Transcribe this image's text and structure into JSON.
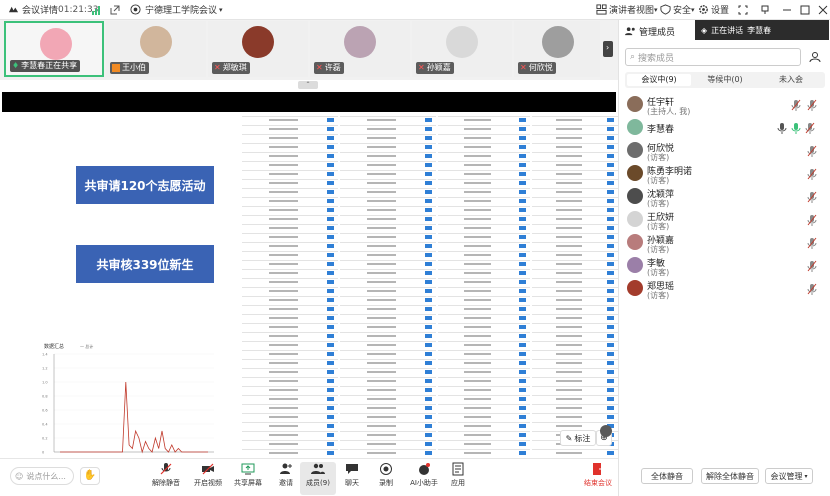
{
  "topbar": {
    "meeting_info": "会议详情",
    "timer": "01:21:33",
    "meeting_title": "宁德理工学院会议",
    "speaker_view": "演讲者视图",
    "security": "安全",
    "settings": "设置"
  },
  "strip": {
    "tiles": [
      {
        "name": "李慧春正在共享",
        "active": true
      },
      {
        "name": "王小伯"
      },
      {
        "name": "郑敏琪"
      },
      {
        "name": "许磊"
      },
      {
        "name": "孙颖嘉"
      },
      {
        "name": "何欣悦"
      }
    ]
  },
  "share": {
    "label1": "共审请120个志愿活动",
    "label2": "共审核339位新生",
    "annotate": "标注",
    "collapse": "⌃",
    "chart_title": "数据汇总",
    "chart_legend": "— 总计"
  },
  "chart_data": {
    "type": "line",
    "title": "数据汇总",
    "xlabel": "",
    "ylabel": "",
    "ylim": [
      0,
      1.4
    ],
    "y_ticks": [
      "1.4",
      "1.2",
      "1.0",
      "0.8",
      "0.6",
      "0.4",
      "0.2",
      "0"
    ],
    "series": [
      {
        "name": "总计",
        "color": "#c0392b",
        "values": [
          0,
          0,
          0,
          0,
          0,
          0,
          0,
          0,
          0,
          0,
          0,
          0,
          0,
          0,
          0,
          0,
          0,
          0,
          0,
          0,
          1.0,
          0.1,
          0.05,
          0.3,
          0.2,
          0,
          0.15,
          0.05,
          0,
          0.2,
          0.05,
          0.3,
          0.05,
          0,
          0.1,
          0,
          0.05,
          0,
          0,
          0,
          0,
          0,
          0,
          0,
          0,
          0
        ]
      }
    ]
  },
  "sharing_banner": {
    "prefix": "正在讲话",
    "name": "李慧春"
  },
  "panel": {
    "title": "管理成员",
    "search_placeholder": "搜索成员",
    "tabs": [
      "会议中(9)",
      "等候中(0)",
      "未入会"
    ],
    "members": [
      {
        "name": "任宇轩",
        "role": "(主持人, 我)",
        "color": "#8a6d5a"
      },
      {
        "name": "李慧春",
        "role": "",
        "color": "#7fb89c"
      },
      {
        "name": "何欣悦",
        "role": "(访客)",
        "color": "#6d6d6d"
      },
      {
        "name": "陈勇李明诺",
        "role": "(访客)",
        "color": "#6b4a2a"
      },
      {
        "name": "沈颖萍",
        "role": "(访客)",
        "color": "#4d4d4d"
      },
      {
        "name": "王欣妍",
        "role": "(访客)",
        "color": "#d4d4d4"
      },
      {
        "name": "孙颖嘉",
        "role": "(访客)",
        "color": "#b87c7c"
      },
      {
        "name": "李敏",
        "role": "(访客)",
        "color": "#9b7fa8"
      },
      {
        "name": "郑思瑶",
        "role": "(访客)",
        "color": "#a33c2c"
      }
    ],
    "mute_all": "全体静音",
    "unmute_all": "解除全体静音",
    "more": "会议管理"
  },
  "toolbar": {
    "chat_placeholder": "说点什么...",
    "tools": [
      {
        "label": "解除静音"
      },
      {
        "label": "开启视频"
      },
      {
        "label": "共享屏幕"
      },
      {
        "label": "邀请"
      },
      {
        "label": "成员(9)"
      },
      {
        "label": "聊天"
      },
      {
        "label": "录制"
      },
      {
        "label": "AI小助手"
      },
      {
        "label": "应用"
      }
    ],
    "leave": "结束会议"
  },
  "colors": {
    "accent": "#3cc17a",
    "label_blue": "#3a63b4",
    "leave_red": "#e0322c"
  }
}
